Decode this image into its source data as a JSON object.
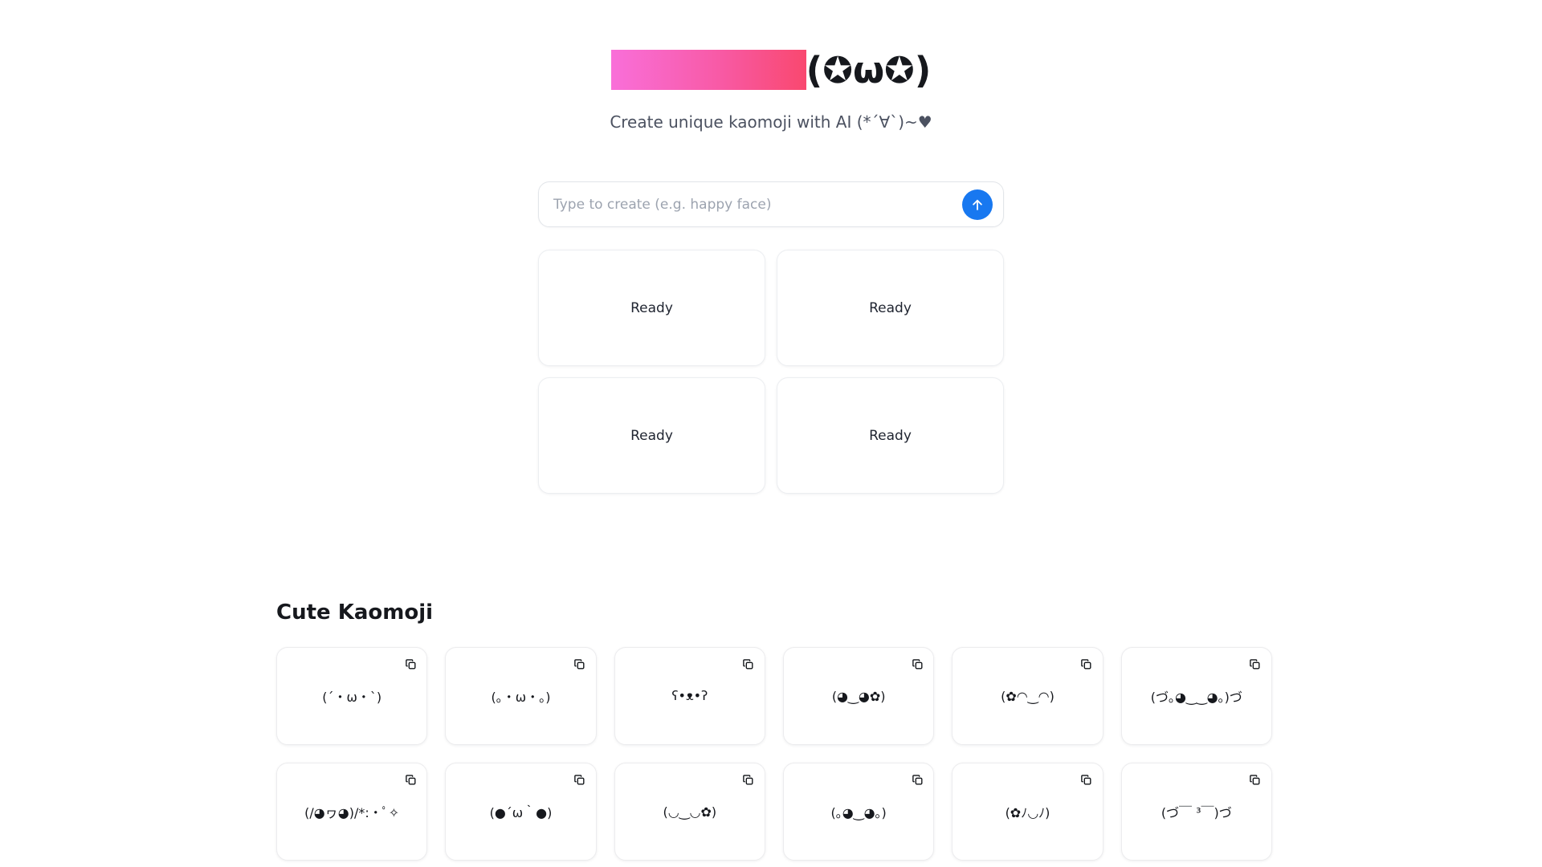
{
  "header": {
    "title_kaomoji": "(✪ω✪)",
    "subtitle": "Create unique kaomoji with AI (*´∀`)~♥",
    "gradient_start": "#f96fd9",
    "gradient_end": "#f9486f"
  },
  "search": {
    "placeholder": "Type to create (e.g. happy face)",
    "value": "",
    "submit_icon": "arrow-up-icon",
    "submit_color": "#1878f0"
  },
  "results": [
    {
      "status": "Ready"
    },
    {
      "status": "Ready"
    },
    {
      "status": "Ready"
    },
    {
      "status": "Ready"
    }
  ],
  "gallery": {
    "title": "Cute Kaomoji",
    "copy_icon": "copy-icon",
    "items": [
      {
        "kaomoji": "(´・ω・`)"
      },
      {
        "kaomoji": "(｡・ω・｡)"
      },
      {
        "kaomoji": "ʕ•ᴥ•ʔ"
      },
      {
        "kaomoji": "(◕‿◕✿)"
      },
      {
        "kaomoji": "(✿◠‿◠)"
      },
      {
        "kaomoji": "(づ｡◕‿‿◕｡)づ"
      },
      {
        "kaomoji": "(/◕ヮ◕)/*:・ﾟ✧"
      },
      {
        "kaomoji": "(●´ω｀●)"
      },
      {
        "kaomoji": "(◡‿◡✿)"
      },
      {
        "kaomoji": "(｡◕‿◕｡)"
      },
      {
        "kaomoji": "(✿ﾉ◡ﾉ)"
      },
      {
        "kaomoji": "(づ￣ ³￣)づ"
      }
    ]
  }
}
